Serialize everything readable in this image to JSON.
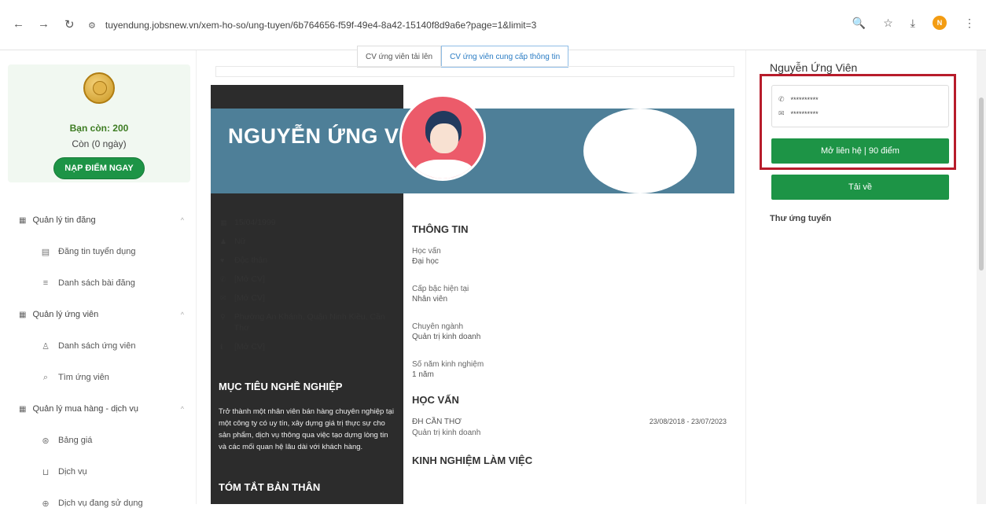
{
  "browser": {
    "url": "tuyendung.jobsnew.vn/xem-ho-so/ung-tuyen/6b764656-f59f-49e4-8a42-15140f8d9a6e?page=1&limit=3",
    "profile_initial": "N",
    "back_icon": "arrow-left-icon",
    "forward_icon": "arrow-right-icon",
    "reload_icon": "reload-icon"
  },
  "sidebar": {
    "balance": "Bạn còn: 200",
    "days": "Còn (0 ngày)",
    "topup_label": "NẠP ĐIỂM NGAY",
    "groups": [
      {
        "label": "Quản lý tin đăng",
        "items": [
          {
            "label": "Đăng tin tuyển dụng",
            "icon": "document-icon"
          },
          {
            "label": "Danh sách bài đăng",
            "icon": "list-icon"
          }
        ]
      },
      {
        "label": "Quản lý ứng viên",
        "items": [
          {
            "label": "Danh sách ứng viên",
            "icon": "user-icon"
          },
          {
            "label": "Tìm ứng viên",
            "icon": "search-icon"
          }
        ]
      },
      {
        "label": "Quản lý mua hàng - dịch vụ",
        "items": [
          {
            "label": "Bảng giá",
            "icon": "price-icon"
          },
          {
            "label": "Dịch vụ",
            "icon": "cart-icon"
          },
          {
            "label": "Dịch vụ đang sử dụng",
            "icon": "service-icon"
          }
        ]
      }
    ]
  },
  "tabs": {
    "uploaded": "CV ứng viên tải lên",
    "provided": "CV ứng viên cung cấp thông tin"
  },
  "cv": {
    "name": "NGUYỄN ỨNG V",
    "facts": {
      "dob": "15/04/1999",
      "gender": "Nữ",
      "marital": "Độc thân",
      "phone": "[Mở CV]",
      "email": "[Mở CV]",
      "address": "Phường An Khánh, Quận Ninh Kiều, Cần Thơ",
      "website": "[Mở CV]"
    },
    "objective_title": "MỤC TIÊU NGHỀ NGHIỆP",
    "objective_text": "Trở thành một nhân viên bán hàng chuyên nghiệp tại một công ty có uy tín, xây dựng giá trị thực sự cho sản phẩm, dịch vụ thông qua việc tạo dựng lòng tin và các mối quan hệ lâu dài với khách hàng.",
    "summary_title": "TÓM TẮT BẢN THÂN",
    "info_title": "THÔNG TIN",
    "info": [
      {
        "label": "Học vấn",
        "value": "Đại học"
      },
      {
        "label": "Cấp bậc hiện tại",
        "value": "Nhân viên"
      },
      {
        "label": "Chuyên ngành",
        "value": "Quản trị kinh doanh"
      },
      {
        "label": "Số năm kinh nghiệm",
        "value": "1 năm"
      }
    ],
    "education_title": "HỌC VẤN",
    "education": {
      "school": "ĐH CẦN THƠ",
      "dates": "23/08/2018 - 23/07/2023",
      "major": "Quản trị kinh doanh"
    },
    "experience_title": "KINH NGHIỆM LÀM VIỆC"
  },
  "right": {
    "candidate_name": "Nguyễn Ứng Viên",
    "phone_masked": "**********",
    "email_masked": "**********",
    "open_contact": "Mở liên hệ | 90 điểm",
    "download": "Tải về",
    "cover_letter": "Thư ứng tuyển"
  },
  "colors": {
    "accent": "#1d9446",
    "highlight": "#b71c2b",
    "banner": "#4e7f98"
  }
}
